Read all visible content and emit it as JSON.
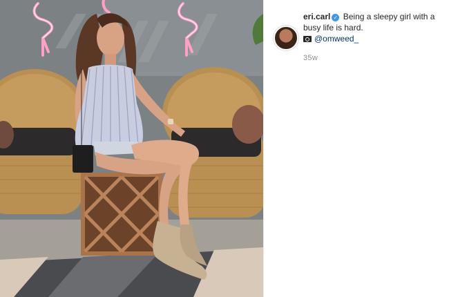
{
  "post": {
    "image_alt": "Woman in striped top sitting on wooden crate between wicker chairs under flamingo neon signs",
    "author": {
      "username": "eri.carl",
      "verified": true
    },
    "caption": {
      "text_line1": "Being a sleepy girl with a",
      "text_line2": "busy life is hard.",
      "camera_icon": "camera-icon",
      "mention": "@omweed_"
    },
    "timestamp": "35w"
  }
}
